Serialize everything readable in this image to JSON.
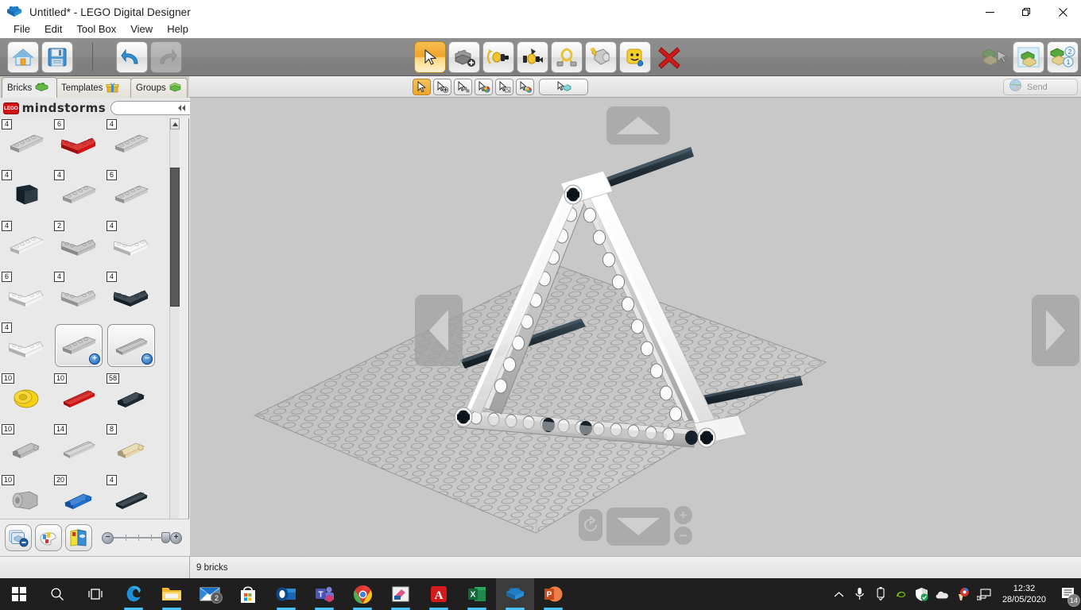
{
  "window": {
    "title": "Untitled* - LEGO Digital Designer",
    "app_icon": "lego-brick-icon",
    "minimize": "minimize-icon",
    "restore": "restore-icon",
    "close": "close-icon"
  },
  "menubar": {
    "items": [
      {
        "label": "File"
      },
      {
        "label": "Edit"
      },
      {
        "label": "Tool Box"
      },
      {
        "label": "View"
      },
      {
        "label": "Help"
      }
    ]
  },
  "toolbar": {
    "left": [
      {
        "name": "home-button",
        "icon": "home-icon",
        "state": "enabled"
      },
      {
        "name": "save-button",
        "icon": "floppy-disk-icon",
        "state": "enabled"
      }
    ],
    "history": [
      {
        "name": "undo-button",
        "icon": "undo-arrow-icon",
        "state": "enabled"
      },
      {
        "name": "redo-button",
        "icon": "redo-arrow-icon",
        "state": "disabled"
      }
    ],
    "tools": [
      {
        "name": "selection-tool",
        "icon": "cursor-arrow-icon",
        "state": "active"
      },
      {
        "name": "clone-tool",
        "icon": "clone-brick-icon",
        "state": "enabled"
      },
      {
        "name": "hinge-tool",
        "icon": "hinge-icon",
        "state": "enabled"
      },
      {
        "name": "hinge-align-tool",
        "icon": "hinge-align-icon",
        "state": "enabled"
      },
      {
        "name": "flex-tool",
        "icon": "flex-rope-icon",
        "state": "enabled"
      },
      {
        "name": "paint-tool",
        "icon": "paint-bucket-icon",
        "state": "enabled"
      },
      {
        "name": "minifig-paint-tool",
        "icon": "minifig-head-icon",
        "state": "enabled"
      },
      {
        "name": "delete-tool",
        "icon": "red-x-icon",
        "state": "enabled"
      }
    ],
    "modes": [
      {
        "name": "build-mode",
        "icon": "build-mode-icon",
        "state": "disabled"
      },
      {
        "name": "view-mode",
        "icon": "view-mode-icon",
        "state": "active"
      },
      {
        "name": "building-guide-mode",
        "icon": "guide-mode-icon",
        "state": "enabled",
        "badge_top": "2",
        "badge_bottom": "1"
      }
    ]
  },
  "subtoolbar": {
    "buttons": [
      {
        "name": "select-single",
        "icon": "cursor-icon",
        "state": "active"
      },
      {
        "name": "select-add",
        "icon": "cursor-plus-icon",
        "state": "enabled"
      },
      {
        "name": "select-none",
        "icon": "cursor-bricks-icon",
        "state": "enabled"
      },
      {
        "name": "select-by-color",
        "icon": "cursor-color-icon",
        "state": "enabled"
      },
      {
        "name": "select-by-shape",
        "icon": "cursor-shape-icon",
        "state": "enabled"
      },
      {
        "name": "select-by-color-and-shape",
        "icon": "cursor-color-shape-icon",
        "state": "enabled"
      }
    ],
    "connected": {
      "name": "select-connected",
      "icon": "cursor-connected-icon"
    },
    "send": {
      "label": "Send",
      "icon": "globe-icon",
      "state": "disabled"
    }
  },
  "tabs": [
    {
      "label": "Bricks",
      "icon": "green-brick-icon",
      "selected": true
    },
    {
      "label": "Templates",
      "icon": "gift-box-icon",
      "selected": false
    },
    {
      "label": "Groups",
      "icon": "stacked-bricks-icon",
      "selected": false
    }
  ],
  "palette": {
    "theme_logo": "LEGO",
    "theme_name": "mindstorms",
    "search_value": "",
    "search_placeholder": "",
    "collapse_icon": "collapse-left-icon",
    "rows": [
      [
        {
          "count": "4",
          "color": "#c9c9c9",
          "shape": "beam",
          "name": "palette-brick"
        },
        {
          "count": "6",
          "color": "#d41212",
          "shape": "angle-beam",
          "name": "palette-brick"
        },
        {
          "count": "4",
          "color": "#c9c9c9",
          "shape": "beam",
          "name": "palette-brick"
        }
      ],
      [
        {
          "count": "4",
          "color": "#1d2a33",
          "shape": "block",
          "name": "palette-brick"
        },
        {
          "count": "4",
          "color": "#c9c9c9",
          "shape": "beam",
          "name": "palette-brick"
        },
        {
          "count": "6",
          "color": "#c9c9c9",
          "shape": "beam",
          "name": "palette-brick"
        }
      ],
      [
        {
          "count": "4",
          "color": "#f2f2f2",
          "shape": "beam",
          "name": "palette-brick"
        },
        {
          "count": "2",
          "color": "#bdbdbd",
          "shape": "angle-beam",
          "name": "palette-brick"
        },
        {
          "count": "4",
          "color": "#f4f4f4",
          "shape": "angle-beam",
          "name": "palette-brick"
        }
      ],
      [
        {
          "count": "6",
          "color": "#f4f4f4",
          "shape": "angle-beam",
          "name": "palette-brick"
        },
        {
          "count": "4",
          "color": "#c9c9c9",
          "shape": "angle-beam",
          "name": "palette-brick"
        },
        {
          "count": "4",
          "color": "#1d2a33",
          "shape": "angle-beam",
          "name": "palette-brick"
        }
      ],
      [
        {
          "count": "4",
          "color": "#f4f4f4",
          "shape": "angle-beam",
          "name": "palette-brick"
        },
        {
          "count": "",
          "color": "#c3c3c3",
          "shape": "beam",
          "framed": true,
          "badge": "+",
          "name": "palette-brick-more"
        },
        {
          "count": "",
          "color": "#bcbcbc",
          "shape": "axle",
          "framed": true,
          "badge": "−",
          "name": "palette-brick-less"
        }
      ],
      [
        {
          "count": "10",
          "color": "#f5d117",
          "shape": "round",
          "name": "palette-brick"
        },
        {
          "count": "10",
          "color": "#d41212",
          "shape": "axle",
          "name": "palette-brick"
        },
        {
          "count": "58",
          "color": "#1d2a33",
          "shape": "pin",
          "name": "palette-brick"
        }
      ],
      [
        {
          "count": "10",
          "color": "#b9b9b9",
          "shape": "pin",
          "name": "palette-brick"
        },
        {
          "count": "14",
          "color": "#cfcfcf",
          "shape": "axle",
          "name": "palette-brick"
        },
        {
          "count": "8",
          "color": "#e6d6a8",
          "shape": "pin",
          "name": "palette-brick"
        }
      ],
      [
        {
          "count": "10",
          "color": "#b4b4b4",
          "shape": "bush",
          "name": "palette-brick"
        },
        {
          "count": "20",
          "color": "#1f6fd0",
          "shape": "pin",
          "name": "palette-brick"
        },
        {
          "count": "4",
          "color": "#1d2a33",
          "shape": "axle",
          "name": "palette-brick"
        }
      ]
    ],
    "footer_buttons": [
      {
        "name": "hide-bricks-button",
        "icon": "layers-minus-icon"
      },
      {
        "name": "color-palette-button",
        "icon": "color-bricks-icon"
      },
      {
        "name": "brick-box-button",
        "icon": "brick-book-icon"
      }
    ],
    "zoom": {
      "minus": "−",
      "plus": "+",
      "name": "palette-zoom-slider"
    }
  },
  "viewport": {
    "nav_left": "nav-arrow-left",
    "nav_right": "nav-arrow-right",
    "nav_up": "nav-arrow-up",
    "nav_down": "nav-arrow-down",
    "reset_view": "reset-view-icon",
    "zoom_in": "+",
    "zoom_out": "−",
    "model_description": "LEGO Technic A-frame triangular structure with white and light-gray beams, black axles and pins on a gray baseplate"
  },
  "statusbar": {
    "brick_count": "9 bricks"
  },
  "taskbar": {
    "items": [
      {
        "name": "start-button",
        "icon": "windows-logo-icon",
        "running": false
      },
      {
        "name": "search-button",
        "icon": "search-icon",
        "running": false
      },
      {
        "name": "task-view-button",
        "icon": "task-view-icon",
        "running": false
      },
      {
        "name": "edge-button",
        "icon": "edge-icon",
        "running": true
      },
      {
        "name": "file-explorer-button",
        "icon": "folder-icon",
        "running": true
      },
      {
        "name": "mail-button",
        "icon": "mail-icon",
        "running": false,
        "badge": "2"
      },
      {
        "name": "store-button",
        "icon": "store-bag-icon",
        "running": false
      },
      {
        "name": "outlook-button",
        "icon": "outlook-icon",
        "running": true
      },
      {
        "name": "teams-button",
        "icon": "teams-icon",
        "running": true
      },
      {
        "name": "chrome-button",
        "icon": "chrome-icon",
        "running": true
      },
      {
        "name": "pdf-creator-button",
        "icon": "pdf-creator-icon",
        "running": true
      },
      {
        "name": "acrobat-button",
        "icon": "acrobat-icon",
        "running": true
      },
      {
        "name": "excel-button",
        "icon": "excel-icon",
        "running": true
      },
      {
        "name": "lego-digital-designer-button",
        "icon": "lego-brick-icon",
        "running": true,
        "active": true
      },
      {
        "name": "powerpoint-button",
        "icon": "powerpoint-icon",
        "running": true
      }
    ],
    "tray": [
      {
        "name": "show-hidden-icons",
        "icon": "chevron-up-icon"
      },
      {
        "name": "microphone-tray-icon",
        "icon": "microphone-icon"
      },
      {
        "name": "safely-remove-hardware-icon",
        "icon": "usb-icon"
      },
      {
        "name": "nvidia-tray-icon",
        "icon": "nvidia-icon"
      },
      {
        "name": "windows-defender-icon",
        "icon": "shield-check-icon"
      },
      {
        "name": "onedrive-tray-icon",
        "icon": "cloud-icon"
      },
      {
        "name": "ccleaner-tray-icon",
        "icon": "ccleaner-icon"
      },
      {
        "name": "network-tray-icon",
        "icon": "network-icon"
      }
    ],
    "clock": {
      "time": "12:32",
      "date": "28/05/2020"
    },
    "notifications": {
      "icon": "notification-icon",
      "count": "14"
    }
  }
}
